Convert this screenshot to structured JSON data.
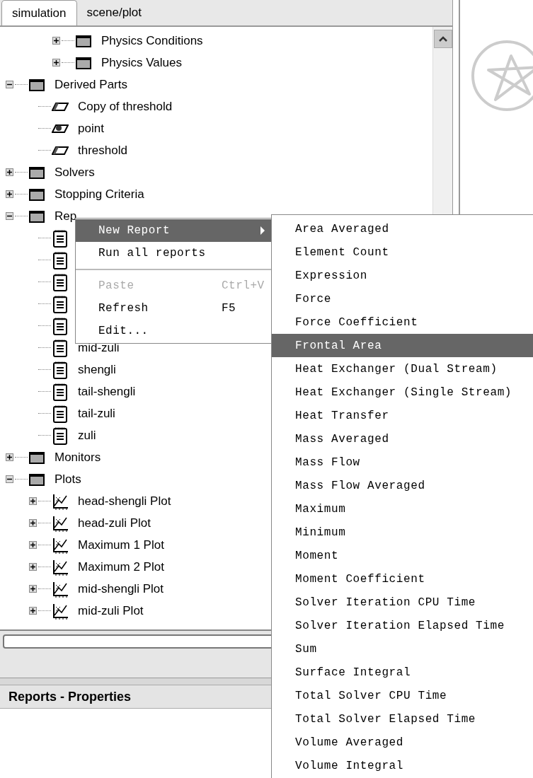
{
  "tabs": [
    {
      "label": "simulation",
      "selected": true
    },
    {
      "label": "scene/plot",
      "selected": false
    }
  ],
  "tree": {
    "partial_children": [
      {
        "label": "Physics Conditions",
        "kind": "folder",
        "expanded": false
      },
      {
        "label": "Physics Values",
        "kind": "folder",
        "expanded": false
      }
    ],
    "items": [
      {
        "label": "Derived Parts",
        "kind": "folder",
        "expanded": true,
        "children": [
          {
            "label": "Copy of threshold",
            "kind": "part"
          },
          {
            "label": "point",
            "kind": "point"
          },
          {
            "label": "threshold",
            "kind": "part"
          }
        ]
      },
      {
        "label": "Solvers",
        "kind": "folder",
        "expanded": false
      },
      {
        "label": "Stopping Criteria",
        "kind": "folder",
        "expanded": false
      },
      {
        "label": "Rep",
        "kind": "folder",
        "expanded": true,
        "children": [
          {
            "kind": "report"
          },
          {
            "kind": "report"
          },
          {
            "kind": "report"
          },
          {
            "kind": "report"
          },
          {
            "kind": "report"
          },
          {
            "label": "mid-zuli",
            "kind": "report"
          },
          {
            "label": "shengli",
            "kind": "report"
          },
          {
            "label": "tail-shengli",
            "kind": "report"
          },
          {
            "label": "tail-zuli",
            "kind": "report"
          },
          {
            "label": "zuli",
            "kind": "report"
          }
        ]
      },
      {
        "label": "Monitors",
        "kind": "folder",
        "expanded": false
      },
      {
        "label": "Plots",
        "kind": "folder",
        "expanded": true,
        "children": [
          {
            "label": "head-shengli Plot",
            "kind": "plot",
            "expanded": false
          },
          {
            "label": "head-zuli Plot",
            "kind": "plot",
            "expanded": false
          },
          {
            "label": "Maximum 1 Plot",
            "kind": "plot",
            "expanded": false
          },
          {
            "label": "Maximum 2 Plot",
            "kind": "plot",
            "expanded": false
          },
          {
            "label": "mid-shengli Plot",
            "kind": "plot",
            "expanded": false
          },
          {
            "label": "mid-zuli Plot",
            "kind": "plot",
            "expanded": false
          }
        ]
      }
    ]
  },
  "properties": {
    "title": "Reports - Properties"
  },
  "context_menu": [
    {
      "kind": "item",
      "label": "New Report",
      "highlighted": true,
      "disabled": false,
      "has_submenu": true
    },
    {
      "kind": "item",
      "label": "Run all reports",
      "highlighted": false,
      "disabled": false,
      "has_submenu": false
    },
    {
      "kind": "separator"
    },
    {
      "kind": "item",
      "label": "Paste",
      "shortcut": "Ctrl+V",
      "highlighted": false,
      "disabled": true,
      "has_submenu": false
    },
    {
      "kind": "item",
      "label": "Refresh",
      "shortcut": "F5",
      "highlighted": false,
      "disabled": false,
      "has_submenu": false
    },
    {
      "kind": "item",
      "label": "Edit...",
      "highlighted": false,
      "disabled": false,
      "has_submenu": false
    }
  ],
  "submenu": [
    {
      "label": "Area Averaged",
      "highlighted": false
    },
    {
      "label": "Element Count",
      "highlighted": false
    },
    {
      "label": "Expression",
      "highlighted": false
    },
    {
      "label": "Force",
      "highlighted": false
    },
    {
      "label": "Force Coefficient",
      "highlighted": false
    },
    {
      "label": "Frontal Area",
      "highlighted": true
    },
    {
      "label": "Heat Exchanger (Dual Stream)",
      "highlighted": false
    },
    {
      "label": "Heat Exchanger (Single Stream)",
      "highlighted": false
    },
    {
      "label": "Heat Transfer",
      "highlighted": false
    },
    {
      "label": "Mass Averaged",
      "highlighted": false
    },
    {
      "label": "Mass Flow",
      "highlighted": false
    },
    {
      "label": "Mass Flow Averaged",
      "highlighted": false
    },
    {
      "label": "Maximum",
      "highlighted": false
    },
    {
      "label": "Minimum",
      "highlighted": false
    },
    {
      "label": "Moment",
      "highlighted": false
    },
    {
      "label": "Moment Coefficient",
      "highlighted": false
    },
    {
      "label": "Solver Iteration CPU Time",
      "highlighted": false
    },
    {
      "label": "Solver Iteration Elapsed Time",
      "highlighted": false
    },
    {
      "label": "Sum",
      "highlighted": false
    },
    {
      "label": "Surface Integral",
      "highlighted": false
    },
    {
      "label": "Total Solver CPU Time",
      "highlighted": false
    },
    {
      "label": "Total Solver Elapsed Time",
      "highlighted": false
    },
    {
      "label": "Volume Averaged",
      "highlighted": false
    },
    {
      "label": "Volume Integral",
      "highlighted": false
    }
  ]
}
